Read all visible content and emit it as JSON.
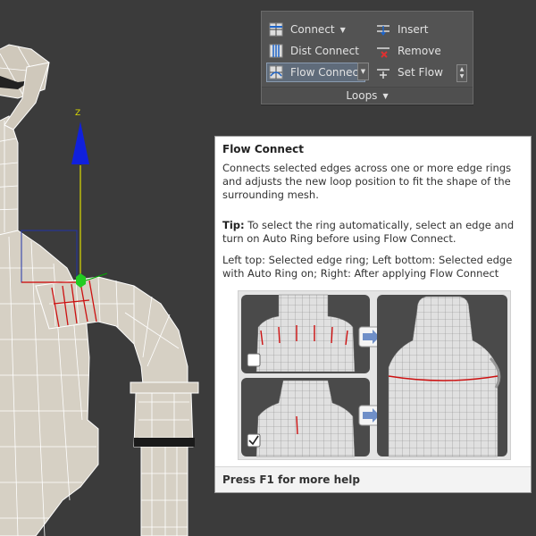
{
  "ribbon": {
    "items": [
      {
        "label": "Connect",
        "icon": "connect-icon"
      },
      {
        "label": "Dist Connect",
        "icon": "dist-connect-icon"
      },
      {
        "label": "Flow Connect",
        "icon": "flow-connect-icon",
        "active": true
      },
      {
        "label": "Insert",
        "icon": "insert-loop-icon"
      },
      {
        "label": "Remove",
        "icon": "remove-loop-icon"
      },
      {
        "label": "Set Flow",
        "icon": "set-flow-icon"
      }
    ],
    "footer_label": "Loops"
  },
  "viewport": {
    "axis_label": "Z",
    "colors": {
      "background": "#3b3b3b",
      "mesh": "#d6d0c4",
      "wire": "#ffffff",
      "selection": "#cc0000",
      "z_axis": "#0000cc",
      "x_axis": "#cc0000",
      "y_axis": "#00cc00"
    }
  },
  "tooltip": {
    "title": "Flow Connect",
    "description": "Connects selected edges across one or more edge rings and adjusts the new loop position to fit the shape of the surrounding mesh.",
    "tip_label": "Tip:",
    "tip_text": " To select the ring automatically, select an edge and turn on Auto Ring before using Flow Connect.",
    "caption": "Left top: Selected edge ring; Left bottom: Selected edge with Auto Ring on; Right: After applying Flow Connect",
    "footer": "Press F1 for more help"
  }
}
